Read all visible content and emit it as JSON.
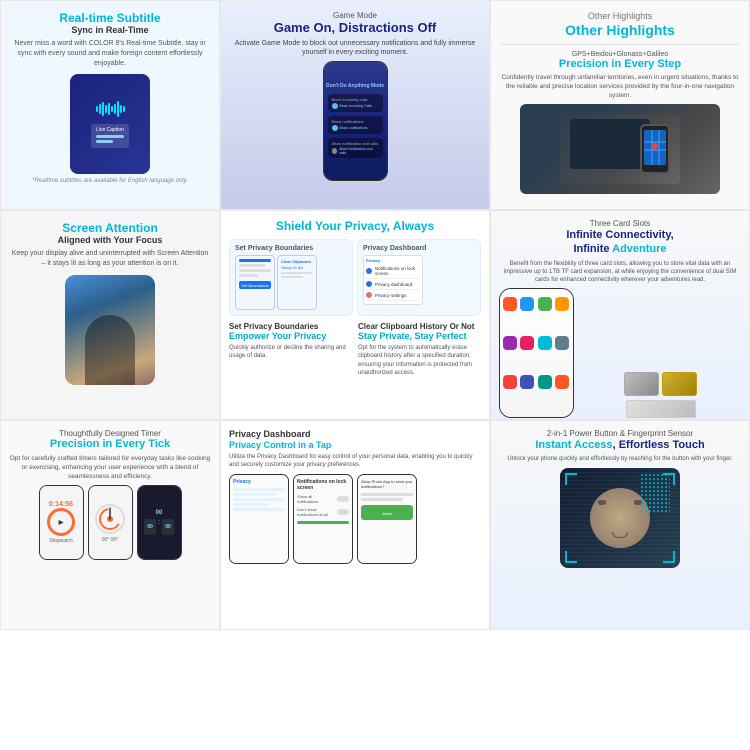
{
  "sections": {
    "realtime_subtitle": {
      "title": "Real-time Subtitle",
      "subtitle": "Sync in Real-Time",
      "description": "Never miss a word with COLOR 8's Real-time Subtitle, stay in sync with every sound and make foreign content effortlessly enjoyable.",
      "note": "*Realtime subtitles are available for English language only.",
      "live_caption": "Live Caption"
    },
    "game_mode": {
      "label": "Game Mode",
      "title": "Game On, Distractions Off",
      "description": "Activate Game Mode to block out unnecessary notifications and fully immerse yourself in every exciting moment.",
      "notif1": "Block Incoming Calls",
      "notif2": "Block notifications",
      "notif3": "Allow Notification and calls"
    },
    "other_highlights": {
      "section": "Other Highlights",
      "gps_label": "GPS+Beidou+Glonass+Galileo",
      "gps_title": "Precision in Every Step",
      "gps_description": "Confidently travel through unfamiliar territories, even in urgent situations, thanks to the reliable and precise location services provided by the four-in-one navigation system."
    },
    "screen_attention": {
      "title": "Screen Attention",
      "subtitle": "Aligned with Your Focus",
      "description": "Keep your display alive and uninterrupted with Screen Attention – it stays lit as long as your attention is on it."
    },
    "shield_privacy": {
      "title": "Shield Your Privacy, Always",
      "card1_title": "Set Privacy Boundaries",
      "card1_sub": "Empower Your Privacy",
      "card1_desc": "Quickly authorize or decline the sharing and usage of data.",
      "card2_title": "Clear Clipboard History Or Not",
      "card2_sub": "Stay Private, Stay Perfect",
      "card2_desc": "Opt for the system to automatically erase clipboard history after a specified duration, ensuring your information is protected from unauthorized access."
    },
    "three_card_slots": {
      "label": "Three Card Slots",
      "title": "Infinite Connectivity, Infinite Adventure",
      "description": "Benefit from the flexibility of three card slots, allowing you to store vital data with an impressive up to 1TB TF card expansion, at while enjoying the convenience of dual SIM cards for enhanced connectivity wherever your adventures lead."
    },
    "timer": {
      "label": "Thoughtfully Designed Timer",
      "title": "Precision in Every Tick",
      "description": "Opt for carefully crafted timers tailored for everyday tasks like cooking or exercising, enhancing your user experience with a blend of seamlessness and efficiency.",
      "time1": "0:14:56",
      "time2": "Stopwatch",
      "dial_label": "00° 00°"
    },
    "privacy_dashboard": {
      "title": "Privacy Dashboard",
      "subtitle": "Privacy Control in a Tap",
      "description": "Utilize the Privacy Dashboard for easy control of your personal data, enabling you to quickly and securely customize your privacy preferences.",
      "toggle1": "Show all notifications",
      "toggle2": "Don't show notifications at all",
      "allow_button": "Allow Photo App to send you notifications?"
    },
    "power_button": {
      "label": "2-in-1 Power Button & Fingerprint Sensor",
      "title": "Instant Access, Effortless Touch",
      "description": "Unlock your phone quickly and effortlessly by reaching for the button with your finger."
    }
  }
}
